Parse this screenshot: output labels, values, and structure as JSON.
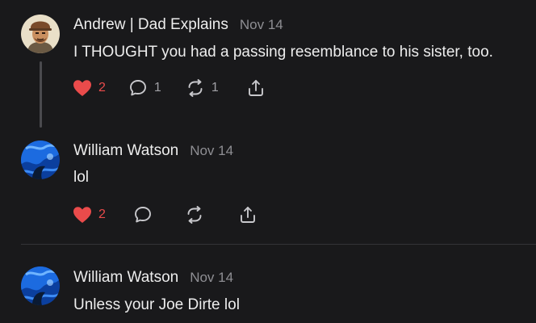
{
  "comments": [
    {
      "author": "Andrew | Dad Explains",
      "date": "Nov 14",
      "text": "I THOUGHT you had a passing resemblance to his sister, too.",
      "likes": "2",
      "replies": "1",
      "restacks": "1",
      "liked": true,
      "avatar_icon": "illustrated-man-portrait"
    },
    {
      "author": "William Watson",
      "date": "Nov 14",
      "text": "lol",
      "likes": "2",
      "liked": true,
      "avatar_icon": "blue-swirl-portrait"
    },
    {
      "author": "William Watson",
      "date": "Nov 14",
      "text": "Unless your Joe Dirte lol",
      "avatar_icon": "blue-swirl-portrait"
    }
  ],
  "colors": {
    "background": "#19191b",
    "text": "#ededed",
    "muted": "#8e8e93",
    "like_red": "#ea4b4b",
    "divider": "#333337"
  },
  "icons": [
    "heart-icon",
    "comment-icon",
    "restack-icon",
    "share-icon"
  ]
}
